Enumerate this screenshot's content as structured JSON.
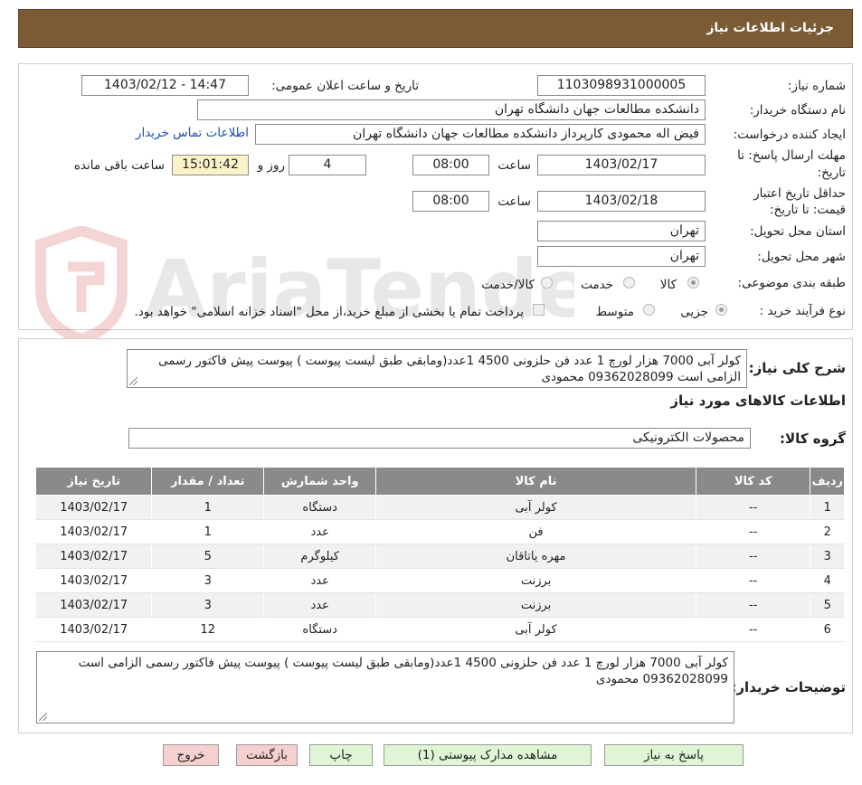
{
  "title": "جزئیات اطلاعات نیاز",
  "watermark": "AriaTender.neT",
  "form": {
    "need_number_label": "شماره نیاز:",
    "need_number": "1103098931000005",
    "announce_label": "تاریخ و ساعت اعلان عمومی:",
    "announce_value": "1403/02/12 - 14:47",
    "buyer_org_label": "نام دستگاه خریدار:",
    "buyer_org": "دانشکده مطالعات جهان دانشگاه تهران",
    "creator_label": "ایجاد کننده درخواست:",
    "creator": "فیض اله محمودی کارپرداز دانشکده مطالعات جهان دانشگاه تهران",
    "contact_link": "اطلاعات تماس خریدار",
    "deadline_label_1": "مهلت ارسال پاسخ: تا",
    "deadline_label_2": "تاریخ:",
    "deadline_date": "1403/02/17",
    "time_label": "ساعت",
    "deadline_time": "08:00",
    "days_value": "4",
    "days_label": "روز و",
    "remaining_time": "15:01:42",
    "remaining_label": "ساعت باقی مانده",
    "validity_label_1": "حداقل تاریخ اعتبار",
    "validity_label_2": "قیمت: تا تاریخ:",
    "validity_date": "1403/02/18",
    "validity_time": "08:00",
    "province_label": "استان محل تحویل:",
    "province": "تهران",
    "city_label": "شهر محل تحویل:",
    "city": "تهران",
    "category_label": "طبقه بندی موضوعی:",
    "category_options": [
      "کالا",
      "خدمت",
      "کالا/خدمت"
    ],
    "process_label": "نوع فرآیند خرید :",
    "process_options": [
      "جزیی",
      "متوسط"
    ],
    "payment_note": "پرداخت تمام یا بخشی از مبلغ خرید،از محل \"اسناد خزانه اسلامی\" خواهد بود."
  },
  "summary": {
    "label": "شرح کلی نیاز:",
    "text": "کولر آبی 7000 هزار لورچ 1 عدد فن حلزونی 4500 1عدد(ومابقی طبق لیست پیوست ) پیوست پیش فاکتور رسمی الزامی است 09362028099 محمودی",
    "goods_info_heading": "اطلاعات کالاهای مورد نیاز",
    "group_label": "گروه کالا:",
    "group_value": "محصولات الکترونیکی"
  },
  "table": {
    "headers": [
      "ردیف",
      "کد کالا",
      "نام کالا",
      "واحد شمارش",
      "تعداد / مقدار",
      "تاریخ نیاز"
    ],
    "rows": [
      [
        "1",
        "--",
        "کولر آبی",
        "دستگاه",
        "1",
        "1403/02/17"
      ],
      [
        "2",
        "--",
        "فن",
        "عدد",
        "1",
        "1403/02/17"
      ],
      [
        "3",
        "--",
        "مهره یاتاقان",
        "کیلوگرم",
        "5",
        "1403/02/17"
      ],
      [
        "4",
        "--",
        "برزنت",
        "عدد",
        "3",
        "1403/02/17"
      ],
      [
        "5",
        "--",
        "برزنت",
        "عدد",
        "3",
        "1403/02/17"
      ],
      [
        "6",
        "--",
        "کولر آبی",
        "دستگاه",
        "12",
        "1403/02/17"
      ]
    ]
  },
  "buyer_notes": {
    "label": "توضیحات خریدار:",
    "text": "کولر آبی 7000 هزار لورچ 1 عدد فن حلزونی 4500 1عدد(ومابقی طبق لیست پیوست ) پیوست پیش فاکتور رسمی الزامی است 09362028099 محمودی"
  },
  "buttons": {
    "reply": "پاسخ به نیاز",
    "attachments": "مشاهده مدارک پیوستی (1)",
    "print": "چاپ",
    "back": "بازگشت",
    "exit": "خروج"
  }
}
